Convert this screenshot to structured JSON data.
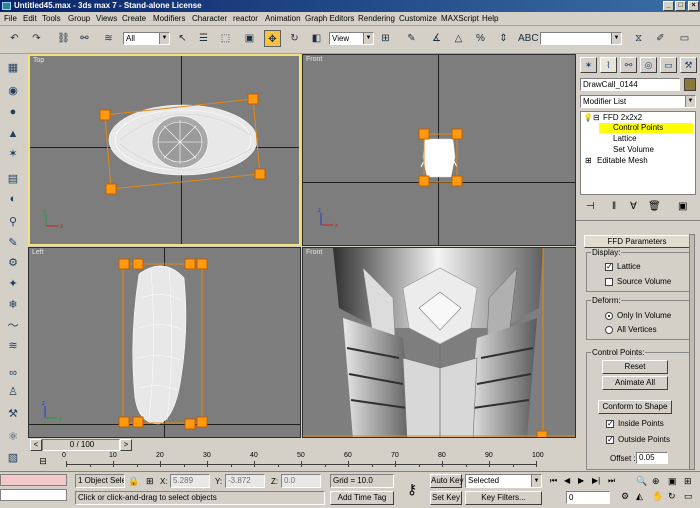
{
  "window": {
    "title": "Untitled45.max - 3ds max 7 - Stand-alone License",
    "controls": [
      "minimize",
      "maximize",
      "close"
    ]
  },
  "menu": [
    "File",
    "Edit",
    "Tools",
    "Group",
    "Views",
    "Create",
    "Modifiers",
    "Character",
    "reactor",
    "Animation",
    "Graph Editors",
    "Rendering",
    "Customize",
    "MAXScript",
    "Help"
  ],
  "toolbar": {
    "selection_filter": "All",
    "reference_coord": "View",
    "named_selection": ""
  },
  "viewports": {
    "top": {
      "label": "Top"
    },
    "front_small": {
      "label": "Front"
    },
    "left": {
      "label": "Left"
    },
    "front_shaded": {
      "label": "Front"
    }
  },
  "command_panel": {
    "object_name": "DrawCall_0144",
    "object_color": "#8a7a3a",
    "modifier_list_label": "Modifier List",
    "stack": {
      "ffd": "FFD 2x2x2",
      "control_points": "Control Points",
      "lattice": "Lattice",
      "set_volume": "Set Volume",
      "editable_mesh": "Editable Mesh"
    },
    "rollout_title": "FFD Parameters",
    "display": {
      "group": "Display:",
      "lattice": "Lattice",
      "lattice_checked": true,
      "source_volume": "Source Volume",
      "source_volume_checked": false
    },
    "deform": {
      "group": "Deform:",
      "only_in_volume": "Only In Volume",
      "all_vertices": "All Vertices",
      "selected": "Only In Volume"
    },
    "control_points": {
      "group": "Control Points:",
      "reset": "Reset",
      "animate_all": "Animate All",
      "conform": "Conform to Shape",
      "inside_points": "Inside Points",
      "inside_checked": true,
      "outside_points": "Outside Points",
      "outside_checked": true,
      "offset_label": "Offset :",
      "offset_value": "0.05"
    }
  },
  "timeline": {
    "frame_display": "0 / 100",
    "ticks": [
      "0",
      "10",
      "20",
      "30",
      "40",
      "50",
      "60",
      "70",
      "80",
      "90",
      "100"
    ]
  },
  "status": {
    "selection": "1 Object Sele",
    "x_label": "X:",
    "x_value": "5.289",
    "y_label": "Y:",
    "y_value": "-3.872",
    "z_label": "Z:",
    "z_value": "0.0",
    "grid": "Grid = 10.0",
    "add_time_tag": "Add Time Tag",
    "prompt": "Click or click-and-drag to select objects",
    "auto_key": "Auto Key",
    "set_key": "Set Key",
    "key_mode": "Selected",
    "key_filters": "Key Filters...",
    "current_frame": "0"
  },
  "colors": {
    "active_viewport_border": "#f2e17a",
    "ffd_handle": "#ff9a10",
    "highlight": "#ffff00"
  }
}
